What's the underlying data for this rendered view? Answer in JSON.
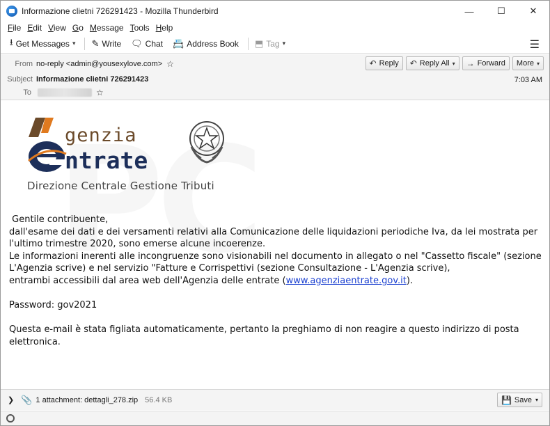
{
  "window": {
    "title": "Informazione clietni 726291423 - Mozilla Thunderbird",
    "minimize": "—",
    "maximize": "☐",
    "close": "✕"
  },
  "menu": {
    "items": [
      {
        "key": "F",
        "rest": "ile"
      },
      {
        "key": "E",
        "rest": "dit"
      },
      {
        "key": "V",
        "rest": "iew"
      },
      {
        "key": "G",
        "rest": "o"
      },
      {
        "key": "M",
        "rest": "essage"
      },
      {
        "key": "T",
        "rest": "ools"
      },
      {
        "key": "H",
        "rest": "elp"
      }
    ]
  },
  "toolbar": {
    "get_messages": "Get Messages",
    "write": "Write",
    "chat": "Chat",
    "address_book": "Address Book",
    "tag": "Tag"
  },
  "header": {
    "from_label": "From",
    "from_value": "no-reply <admin@yousexylove.com>",
    "subject_label": "Subject",
    "subject_value": "Informazione clietni 726291423",
    "to_label": "To",
    "time": "7:03 AM",
    "reply": "Reply",
    "reply_all": "Reply All",
    "forward": "Forward",
    "more": "More"
  },
  "logo": {
    "word1": "genzia",
    "word2": "ntrate",
    "subtitle": "Direzione Centrale Gestione Tributi",
    "colors": {
      "brown": "#6b4a2a",
      "navy": "#1d2f5a",
      "orange": "#e07a1f"
    }
  },
  "body": {
    "greeting": " Gentile contribuente,",
    "line1": "dall'esame dei dati e dei versamenti relativi alla Comunicazione delle liquidazioni periodiche Iva, da lei mostrata per l'ultimo trimestre 2020, sono emerse alcune incoerenze.",
    "line2": "Le informazioni inerenti alle incongruenze sono visionabili nel documento in allegato o nel \"Cassetto fiscale\" (sezione L'Agenzia scrive) e nel servizio \"Fatture e Corrispettivi (sezione Consultazione - L'Agenzia scrive),",
    "line3_pre": "entrambi accessibili dal area web dell'Agenzia delle entrate (",
    "line3_link": "www.agenziaentrate.gov.it",
    "line3_post": ").",
    "password": "Password: gov2021",
    "footer": "Questa e-mail è stata figliata automaticamente, pertanto la preghiamo di non reagire a questo indirizzo di posta elettronica."
  },
  "attachment": {
    "label": "1 attachment: dettagli_278.zip",
    "size": "56.4 KB",
    "save": "Save"
  }
}
